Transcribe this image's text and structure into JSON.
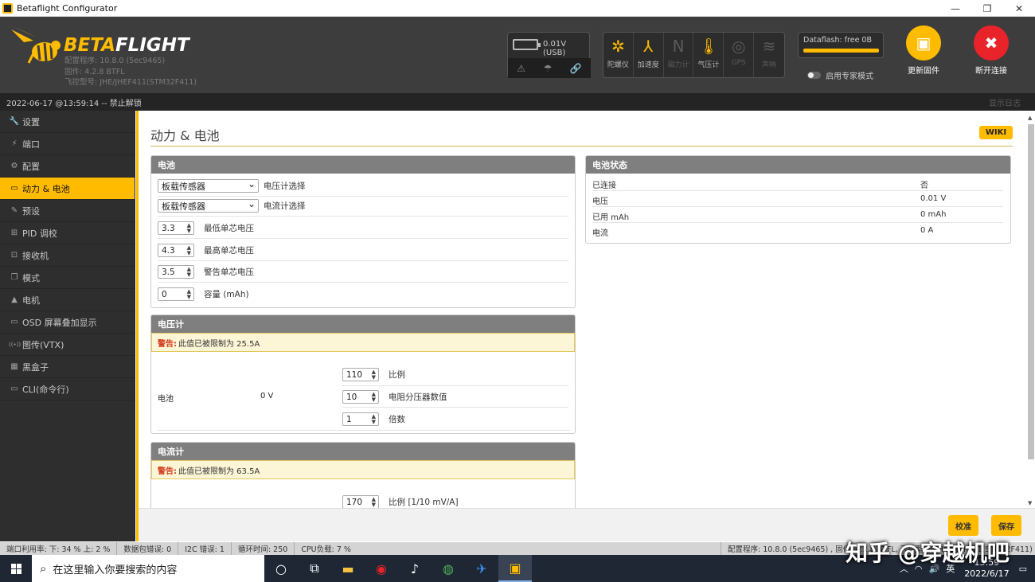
{
  "window": {
    "title": "Betaflight Configurator"
  },
  "header": {
    "brand": "BETAFLIGHT",
    "brand_beta": "BETA",
    "brand_flight": "FLIGHT",
    "version_lines": [
      "配置程序: 10.8.0 (5ec9465)",
      "固件: 4.2.8 BTFL",
      "飞控型号: JHE/JHEF411(STM32F411)"
    ],
    "power": "0.01V (USB)",
    "sensors": [
      {
        "label": "陀螺仪",
        "icon": "gyro-icon",
        "on": true,
        "glyph": "✲"
      },
      {
        "label": "加速度",
        "icon": "accel-icon",
        "on": true,
        "glyph": "⅄"
      },
      {
        "label": "磁力计",
        "icon": "mag-icon",
        "on": false,
        "glyph": "N"
      },
      {
        "label": "气压计",
        "icon": "baro-icon",
        "on": true,
        "glyph": "🌡"
      },
      {
        "label": "GPS",
        "icon": "gps-icon",
        "on": false,
        "glyph": "◎"
      },
      {
        "label": "声呐",
        "icon": "sonar-icon",
        "on": false,
        "glyph": "≋"
      }
    ],
    "dataflash": "Dataflash: free 0B",
    "expert_mode": "启用专家模式",
    "update_fw": "更新固件",
    "disconnect": "断开连接"
  },
  "status": {
    "left": "2022-06-17 @13:59:14 -- 禁止解锁",
    "right": "显示日志"
  },
  "sidebar": {
    "items": [
      {
        "label": "设置",
        "icon": "wrench-icon",
        "glyph": "🔧"
      },
      {
        "label": "端口",
        "icon": "plug-icon",
        "glyph": "⚡"
      },
      {
        "label": "配置",
        "icon": "gear-icon",
        "glyph": "⚙"
      },
      {
        "label": "动力 & 电池",
        "icon": "battery-icon",
        "glyph": "▭"
      },
      {
        "label": "预设",
        "icon": "wand-icon",
        "glyph": "✎"
      },
      {
        "label": "PID 调校",
        "icon": "pid-icon",
        "glyph": "⊞"
      },
      {
        "label": "接收机",
        "icon": "receiver-icon",
        "glyph": "⊡"
      },
      {
        "label": "模式",
        "icon": "modes-icon",
        "glyph": "❐"
      },
      {
        "label": "电机",
        "icon": "motor-icon",
        "glyph": "▲"
      },
      {
        "label": "OSD 屏幕叠加显示",
        "icon": "osd-icon",
        "glyph": "▭"
      },
      {
        "label": "图传(VTX)",
        "icon": "vtx-icon",
        "glyph": "((•))"
      },
      {
        "label": "黑盒子",
        "icon": "blackbox-icon",
        "glyph": "▦"
      },
      {
        "label": "CLI(命令行)",
        "icon": "cli-icon",
        "glyph": "▭"
      }
    ],
    "active_index": 3
  },
  "page": {
    "title": "动力 & 电池",
    "wiki": "WIKI",
    "battery": {
      "header": "电池",
      "voltage_meter_select": "板载传感器",
      "voltage_meter_label": "电压计选择",
      "current_meter_select": "板载传感器",
      "current_meter_label": "电流计选择",
      "min_cell": {
        "value": "3.3",
        "label": "最低单芯电压"
      },
      "max_cell": {
        "value": "4.3",
        "label": "最高单芯电压"
      },
      "warn_cell": {
        "value": "3.5",
        "label": "警告单芯电压"
      },
      "capacity": {
        "value": "0",
        "label": "容量 (mAh)"
      }
    },
    "voltage_meter": {
      "header": "电压计",
      "warn_prefix": "警告:",
      "warn_text": "此值已被限制为 25.5A",
      "source": "电池",
      "reading": "0 V",
      "scale": {
        "value": "110",
        "label": "比例"
      },
      "divider": {
        "value": "10",
        "label": "电阻分压器数值"
      },
      "multiplier": {
        "value": "1",
        "label": "倍数"
      }
    },
    "current_meter": {
      "header": "电流计",
      "warn_prefix": "警告:",
      "warn_text": "此值已被限制为 63.5A",
      "scale": {
        "value": "170",
        "label": "比例 [1/10 mV/A]"
      }
    },
    "battery_state": {
      "header": "电池状态",
      "rows": [
        {
          "k": "已连接",
          "v": "否"
        },
        {
          "k": "电压",
          "v": "0.01 V"
        },
        {
          "k": "已用 mAh",
          "v": "0 mAh"
        },
        {
          "k": "电流",
          "v": "0 A"
        }
      ]
    },
    "calibrate": "校准",
    "save": "保存"
  },
  "footer": {
    "port_util": "端口利用率:  下: 34 %  上: 2 %",
    "packet_err": "数据包错误: 0",
    "i2c_err": "I2C 错误: 1",
    "cycle": "循环时间: 250",
    "cpu": "CPU负载: 7 %",
    "right": "配置程序: 10.8.0 (5ec9465) , 固件: 4.2.8 BTFL, 飞控型号: JHE/JHEF411(STM32F411)"
  },
  "taskbar": {
    "search_placeholder": "在这里输入你要搜索的内容",
    "ime": "英",
    "time": "13:59",
    "date": "2022/6/17"
  },
  "watermark": "知乎 @穿越机吧",
  "colors": {
    "accent": "#ffbb00",
    "header_bg": "#3d3d3d",
    "sidebar_bg": "#2e2e2e",
    "danger": "#e8232a"
  }
}
